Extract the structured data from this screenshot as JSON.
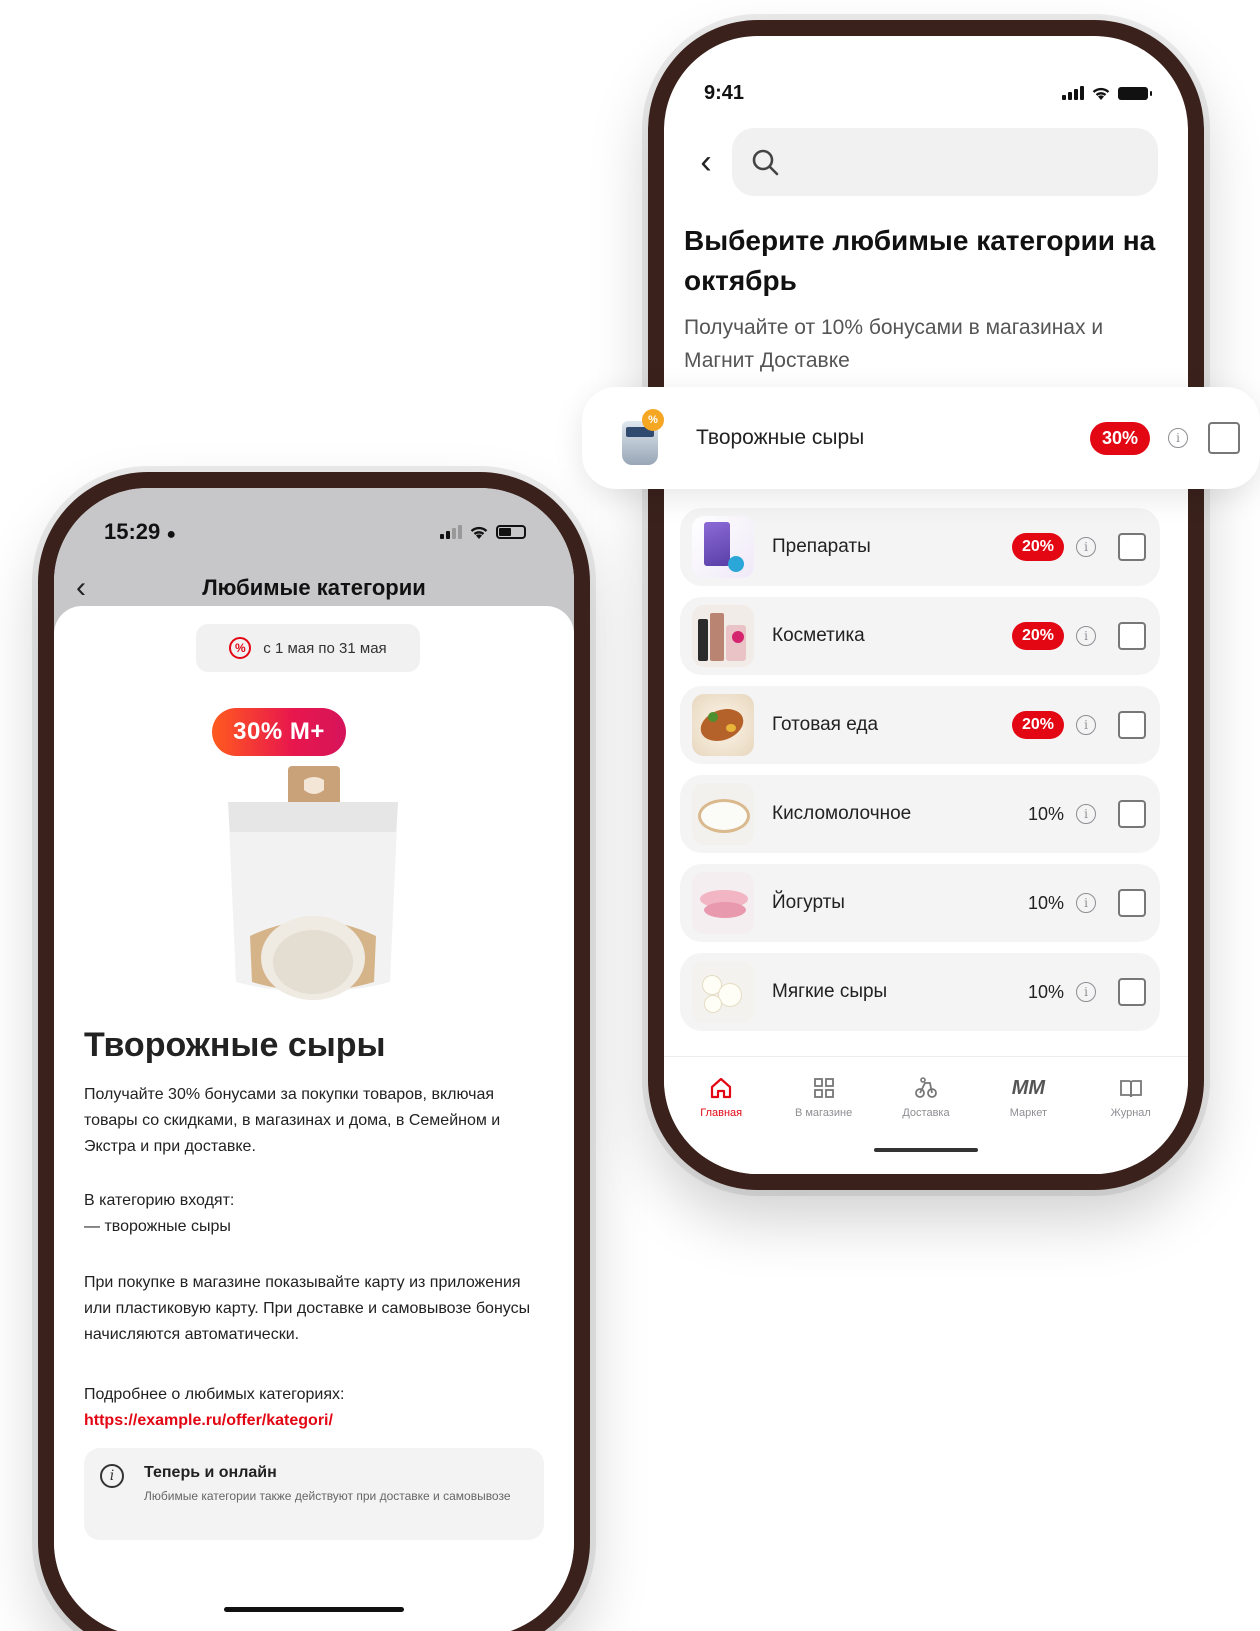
{
  "right_phone": {
    "status": {
      "time": "9:41"
    },
    "title": "Выберите любимые категории на октябрь",
    "subtitle": "Получайте от 10% бонусами в магазинах и Магнит Доставке",
    "highlighted": {
      "label": "Творожные сыры",
      "percent": "30%"
    },
    "categories": [
      {
        "label": "Препараты",
        "percent": "20%",
        "highlight": true
      },
      {
        "label": "Косметика",
        "percent": "20%",
        "highlight": true
      },
      {
        "label": "Готовая еда",
        "percent": "20%",
        "highlight": true
      },
      {
        "label": "Кисломолочное",
        "percent": "10%",
        "highlight": false
      },
      {
        "label": "Йогурты",
        "percent": "10%",
        "highlight": false
      },
      {
        "label": "Мягкие сыры",
        "percent": "10%",
        "highlight": false
      }
    ],
    "tabs": [
      {
        "label": "Главная",
        "icon": "home-icon",
        "active": true
      },
      {
        "label": "В магазине",
        "icon": "grid-icon",
        "active": false
      },
      {
        "label": "Доставка",
        "icon": "delivery-icon",
        "active": false
      },
      {
        "label": "Маркет",
        "icon": "market-logo-icon",
        "active": false
      },
      {
        "label": "Журнал",
        "icon": "book-icon",
        "active": false
      }
    ],
    "market_logo_text": "MM"
  },
  "left_phone": {
    "status": {
      "time": "15:29"
    },
    "nav_title": "Любимые категории",
    "date_range": "с 1 мая по 31 мая",
    "promo_badge": "30% M+",
    "heading": "Творожные сыры",
    "paragraph_1": "Получайте 30% бонусами за покупки товаров, включая товары со скидками, в магазинах и дома, в Семейном и Экстра и при доставке.",
    "paragraph_2_line1": "В категорию входят:",
    "paragraph_2_line2": "— творожные сыры",
    "paragraph_3": "При покупке в магазине показывайте карту из приложения или пластиковую карту. При доставке и самовывозе бонусы начисляются автоматически.",
    "more_label": "Подробнее о любимых категориях:",
    "more_link": "https://example.ru/offer/kategori/",
    "notice_title": "Теперь и онлайн",
    "notice_text": "Любимые категории также действуют при доставке и самовывозе"
  },
  "colors": {
    "accent": "#e30613",
    "frame": "#3a211c"
  }
}
